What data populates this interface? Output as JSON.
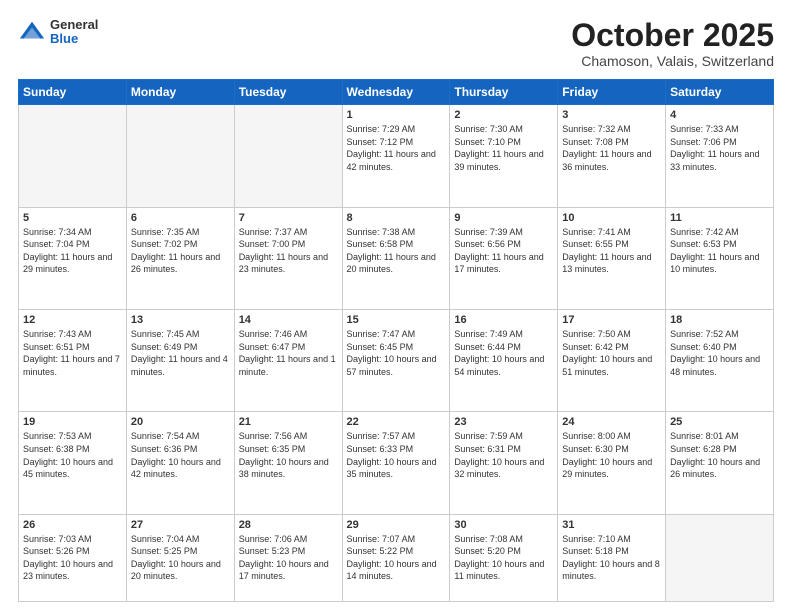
{
  "header": {
    "logo_general": "General",
    "logo_blue": "Blue",
    "month_title": "October 2025",
    "location": "Chamoson, Valais, Switzerland"
  },
  "days_of_week": [
    "Sunday",
    "Monday",
    "Tuesday",
    "Wednesday",
    "Thursday",
    "Friday",
    "Saturday"
  ],
  "weeks": [
    [
      {
        "day": "",
        "empty": true
      },
      {
        "day": "",
        "empty": true
      },
      {
        "day": "",
        "empty": true
      },
      {
        "day": "1",
        "sunrise": "7:29 AM",
        "sunset": "7:12 PM",
        "daylight": "11 hours and 42 minutes."
      },
      {
        "day": "2",
        "sunrise": "7:30 AM",
        "sunset": "7:10 PM",
        "daylight": "11 hours and 39 minutes."
      },
      {
        "day": "3",
        "sunrise": "7:32 AM",
        "sunset": "7:08 PM",
        "daylight": "11 hours and 36 minutes."
      },
      {
        "day": "4",
        "sunrise": "7:33 AM",
        "sunset": "7:06 PM",
        "daylight": "11 hours and 33 minutes."
      }
    ],
    [
      {
        "day": "5",
        "sunrise": "7:34 AM",
        "sunset": "7:04 PM",
        "daylight": "11 hours and 29 minutes."
      },
      {
        "day": "6",
        "sunrise": "7:35 AM",
        "sunset": "7:02 PM",
        "daylight": "11 hours and 26 minutes."
      },
      {
        "day": "7",
        "sunrise": "7:37 AM",
        "sunset": "7:00 PM",
        "daylight": "11 hours and 23 minutes."
      },
      {
        "day": "8",
        "sunrise": "7:38 AM",
        "sunset": "6:58 PM",
        "daylight": "11 hours and 20 minutes."
      },
      {
        "day": "9",
        "sunrise": "7:39 AM",
        "sunset": "6:56 PM",
        "daylight": "11 hours and 17 minutes."
      },
      {
        "day": "10",
        "sunrise": "7:41 AM",
        "sunset": "6:55 PM",
        "daylight": "11 hours and 13 minutes."
      },
      {
        "day": "11",
        "sunrise": "7:42 AM",
        "sunset": "6:53 PM",
        "daylight": "11 hours and 10 minutes."
      }
    ],
    [
      {
        "day": "12",
        "sunrise": "7:43 AM",
        "sunset": "6:51 PM",
        "daylight": "11 hours and 7 minutes."
      },
      {
        "day": "13",
        "sunrise": "7:45 AM",
        "sunset": "6:49 PM",
        "daylight": "11 hours and 4 minutes."
      },
      {
        "day": "14",
        "sunrise": "7:46 AM",
        "sunset": "6:47 PM",
        "daylight": "11 hours and 1 minute."
      },
      {
        "day": "15",
        "sunrise": "7:47 AM",
        "sunset": "6:45 PM",
        "daylight": "10 hours and 57 minutes."
      },
      {
        "day": "16",
        "sunrise": "7:49 AM",
        "sunset": "6:44 PM",
        "daylight": "10 hours and 54 minutes."
      },
      {
        "day": "17",
        "sunrise": "7:50 AM",
        "sunset": "6:42 PM",
        "daylight": "10 hours and 51 minutes."
      },
      {
        "day": "18",
        "sunrise": "7:52 AM",
        "sunset": "6:40 PM",
        "daylight": "10 hours and 48 minutes."
      }
    ],
    [
      {
        "day": "19",
        "sunrise": "7:53 AM",
        "sunset": "6:38 PM",
        "daylight": "10 hours and 45 minutes."
      },
      {
        "day": "20",
        "sunrise": "7:54 AM",
        "sunset": "6:36 PM",
        "daylight": "10 hours and 42 minutes."
      },
      {
        "day": "21",
        "sunrise": "7:56 AM",
        "sunset": "6:35 PM",
        "daylight": "10 hours and 38 minutes."
      },
      {
        "day": "22",
        "sunrise": "7:57 AM",
        "sunset": "6:33 PM",
        "daylight": "10 hours and 35 minutes."
      },
      {
        "day": "23",
        "sunrise": "7:59 AM",
        "sunset": "6:31 PM",
        "daylight": "10 hours and 32 minutes."
      },
      {
        "day": "24",
        "sunrise": "8:00 AM",
        "sunset": "6:30 PM",
        "daylight": "10 hours and 29 minutes."
      },
      {
        "day": "25",
        "sunrise": "8:01 AM",
        "sunset": "6:28 PM",
        "daylight": "10 hours and 26 minutes."
      }
    ],
    [
      {
        "day": "26",
        "sunrise": "7:03 AM",
        "sunset": "5:26 PM",
        "daylight": "10 hours and 23 minutes."
      },
      {
        "day": "27",
        "sunrise": "7:04 AM",
        "sunset": "5:25 PM",
        "daylight": "10 hours and 20 minutes."
      },
      {
        "day": "28",
        "sunrise": "7:06 AM",
        "sunset": "5:23 PM",
        "daylight": "10 hours and 17 minutes."
      },
      {
        "day": "29",
        "sunrise": "7:07 AM",
        "sunset": "5:22 PM",
        "daylight": "10 hours and 14 minutes."
      },
      {
        "day": "30",
        "sunrise": "7:08 AM",
        "sunset": "5:20 PM",
        "daylight": "10 hours and 11 minutes."
      },
      {
        "day": "31",
        "sunrise": "7:10 AM",
        "sunset": "5:18 PM",
        "daylight": "10 hours and 8 minutes."
      },
      {
        "day": "",
        "empty": true
      }
    ]
  ],
  "labels": {
    "sunrise": "Sunrise:",
    "sunset": "Sunset:",
    "daylight": "Daylight:"
  }
}
